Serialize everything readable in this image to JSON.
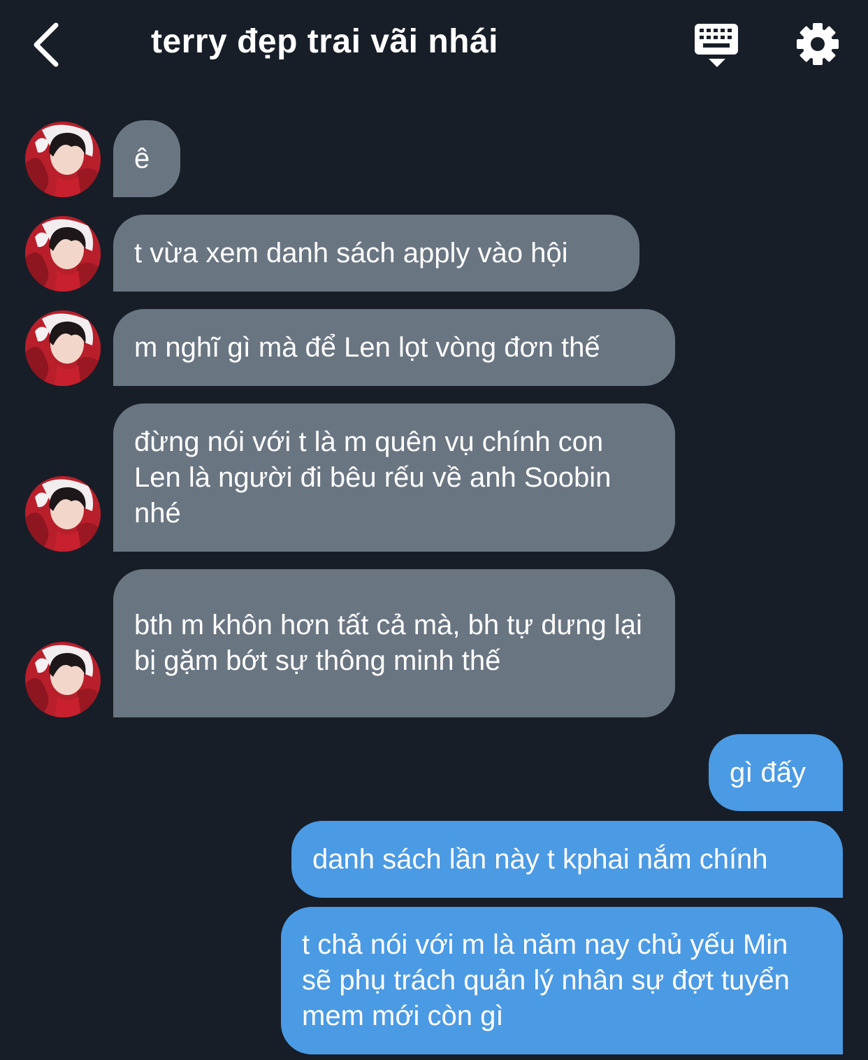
{
  "header": {
    "title": "terry đẹp trai vãi nhái"
  },
  "messages": [
    {
      "text": "ê"
    },
    {
      "text": "t vừa xem danh sách apply vào hội"
    },
    {
      "text": "m nghĩ gì mà để Len lọt vòng đơn thế"
    },
    {
      "text": "đừng nói với t là m quên vụ chính con Len là người đi bêu rếu về anh Soobin nhé"
    },
    {
      "text": "bth m khôn hơn tất cả mà, bh tự dưng lại bị gặm bớt sự thông minh thế"
    },
    {
      "text": "gì đấy"
    },
    {
      "text": "danh sách lần này t kphai nắm chính"
    },
    {
      "text": "t chả nói với m là năm nay chủ yếu Min sẽ phụ trách quản lý nhân sự đợt tuyển mem mới còn gì"
    }
  ],
  "icons": {
    "back": "chevron-left-icon",
    "keyboard": "keyboard-icon",
    "settings": "gear-icon",
    "avatar": "avatar"
  },
  "colors": {
    "background": "#171e28",
    "incoming_bubble": "#6a7582",
    "outgoing_bubble": "#4b9ae4",
    "text": "#ffffff"
  }
}
